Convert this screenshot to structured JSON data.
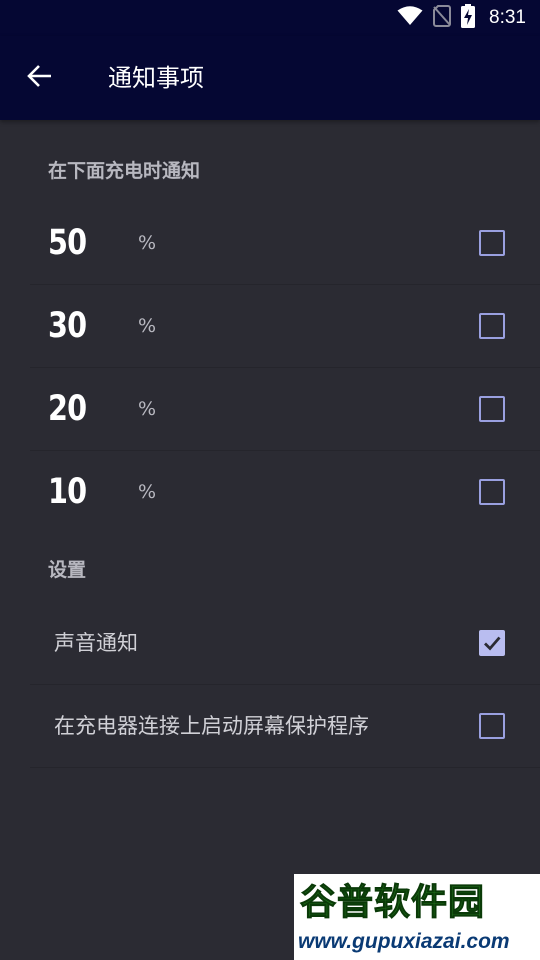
{
  "status_bar": {
    "time": "8:31",
    "icons": [
      "wifi-icon",
      "no-sim-icon",
      "battery-charging-icon"
    ]
  },
  "app_bar": {
    "title": "通知事项",
    "back_icon": "arrow-left-icon"
  },
  "charging_section": {
    "header": "在下面充电时通知",
    "items": [
      {
        "value": "50",
        "unit": "%",
        "checked": false
      },
      {
        "value": "30",
        "unit": "%",
        "checked": false
      },
      {
        "value": "20",
        "unit": "%",
        "checked": false
      },
      {
        "value": "10",
        "unit": "%",
        "checked": false
      }
    ]
  },
  "settings_section": {
    "header": "设置",
    "items": [
      {
        "label": "声音通知",
        "checked": true
      },
      {
        "label": "在充电器连接上启动屏幕保护程序",
        "checked": false
      }
    ]
  },
  "watermark": {
    "title": "谷普软件园",
    "url": "www.gupuxiazai.com"
  },
  "colors": {
    "app_bar_bg": "#050733",
    "page_bg": "#2b2b33",
    "checkbox_accent": "#9aa0e0",
    "checkbox_checked": "#b9bdf0"
  }
}
